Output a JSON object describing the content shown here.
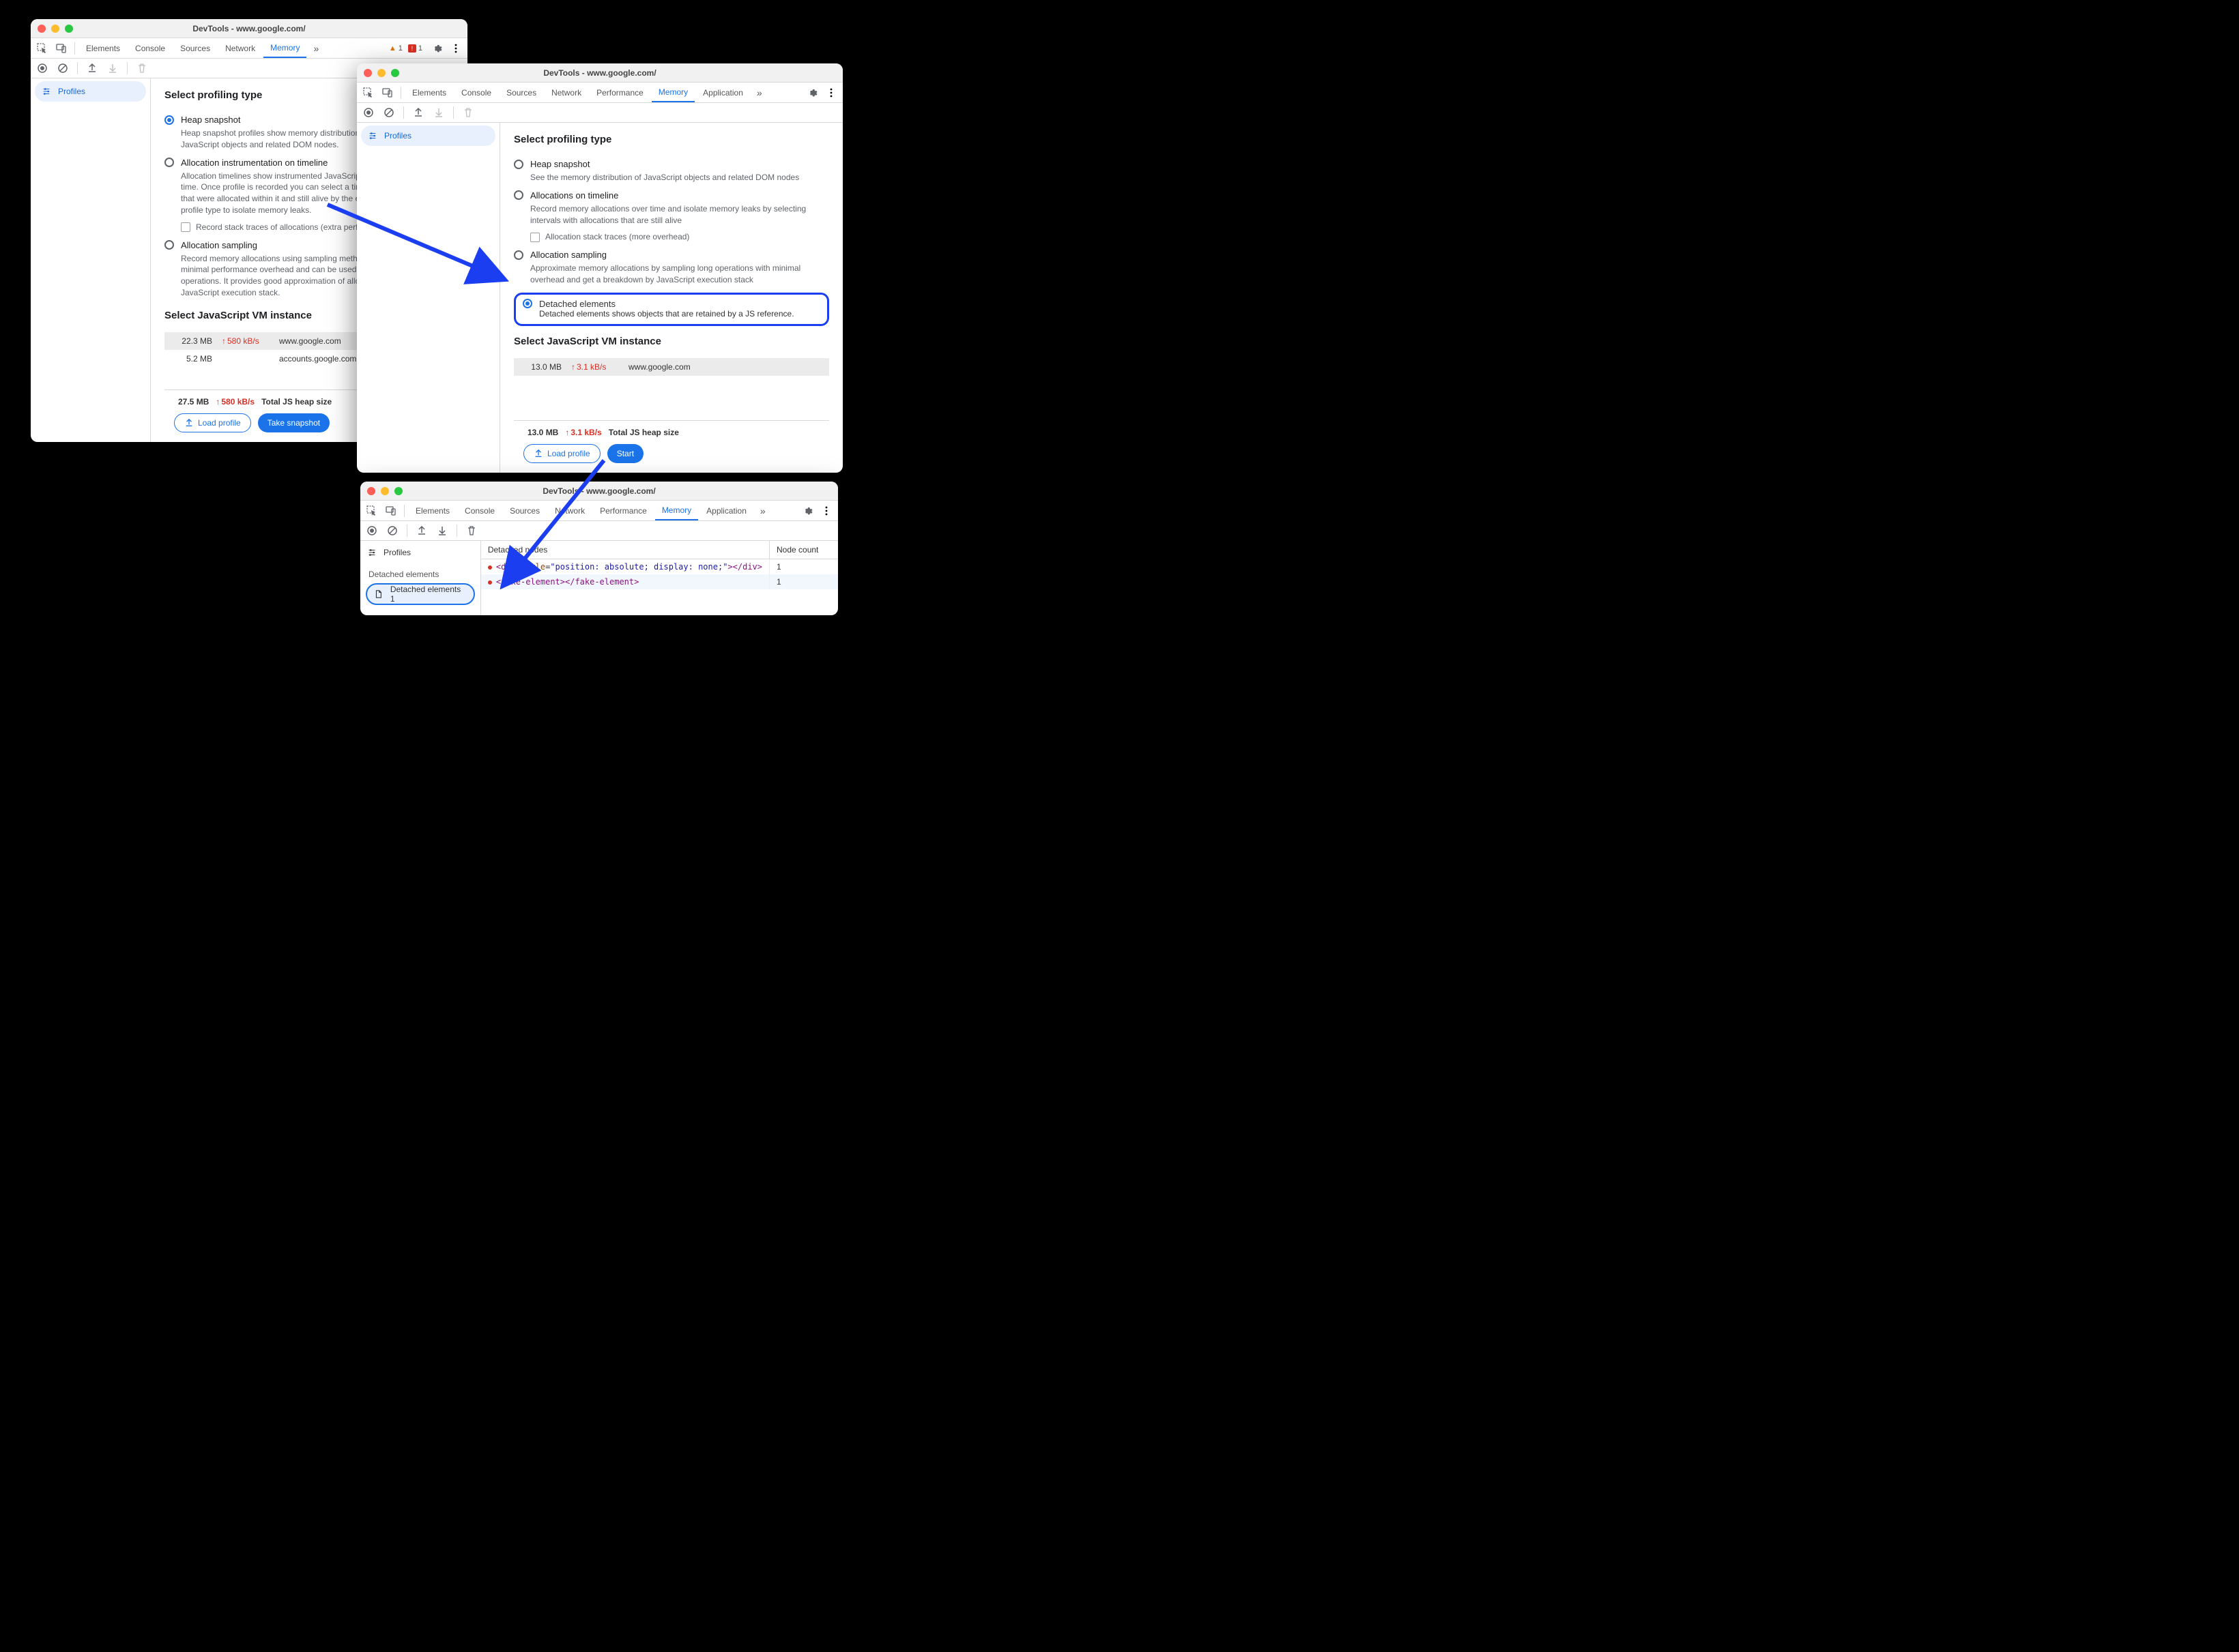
{
  "win1": {
    "title": "DevTools - www.google.com/",
    "tabs": [
      "Elements",
      "Console",
      "Sources",
      "Network",
      "Memory"
    ],
    "activeTab": "Memory",
    "warnCount": "1",
    "errCount": "1",
    "sidebar": {
      "profiles": "Profiles"
    },
    "heading": "Select profiling type",
    "opts": {
      "heap": {
        "label": "Heap snapshot",
        "desc": "Heap snapshot profiles show memory distribution among your page's JavaScript objects and related DOM nodes."
      },
      "timeline": {
        "label": "Allocation instrumentation on timeline",
        "desc": "Allocation timelines show instrumented JavaScript memory allocations over time. Once profile is recorded you can select a time interval to see objects that were allocated within it and still alive by the end of recording. Use this profile type to isolate memory leaks.",
        "check": "Record stack traces of allocations (extra performance overhead)"
      },
      "sampling": {
        "label": "Allocation sampling",
        "desc": "Record memory allocations using sampling method. This profile type has minimal performance overhead and can be used for long running operations. It provides good approximation of allocations broken down by JavaScript execution stack."
      }
    },
    "vmHeading": "Select JavaScript VM instance",
    "vm": [
      {
        "size": "22.3 MB",
        "rate": "580 kB/s",
        "host": "www.google.com"
      },
      {
        "size": "5.2 MB",
        "rate": "",
        "host": "accounts.google.com: Root domain"
      }
    ],
    "total": {
      "size": "27.5 MB",
      "rate": "580 kB/s",
      "label": "Total JS heap size"
    },
    "buttons": {
      "load": "Load profile",
      "snap": "Take snapshot"
    }
  },
  "win2": {
    "title": "DevTools - www.google.com/",
    "tabs": [
      "Elements",
      "Console",
      "Sources",
      "Network",
      "Performance",
      "Memory",
      "Application"
    ],
    "activeTab": "Memory",
    "sidebar": {
      "profiles": "Profiles"
    },
    "heading": "Select profiling type",
    "opts": {
      "heap": {
        "label": "Heap snapshot",
        "desc": "See the memory distribution of JavaScript objects and related DOM nodes"
      },
      "timeline": {
        "label": "Allocations on timeline",
        "desc": "Record memory allocations over time and isolate memory leaks by selecting intervals with allocations that are still alive",
        "check": "Allocation stack traces (more overhead)"
      },
      "sampling": {
        "label": "Allocation sampling",
        "desc": "Approximate memory allocations by sampling long operations with minimal overhead and get a breakdown by JavaScript execution stack"
      },
      "detached": {
        "label": "Detached elements",
        "desc": "Detached elements shows objects that are retained by a JS reference."
      }
    },
    "vmHeading": "Select JavaScript VM instance",
    "vm": [
      {
        "size": "13.0 MB",
        "rate": "3.1 kB/s",
        "host": "www.google.com"
      }
    ],
    "total": {
      "size": "13.0 MB",
      "rate": "3.1 kB/s",
      "label": "Total JS heap size"
    },
    "buttons": {
      "load": "Load profile",
      "start": "Start"
    }
  },
  "win3": {
    "title": "DevTools - www.google.com/",
    "tabs": [
      "Elements",
      "Console",
      "Sources",
      "Network",
      "Performance",
      "Memory",
      "Application"
    ],
    "activeTab": "Memory",
    "sidebar": {
      "profiles": "Profiles",
      "section": "Detached elements",
      "item": "Detached elements 1"
    },
    "grid": {
      "h1": "Detached nodes",
      "h2": "Node count",
      "rows": [
        {
          "html": "<div style=\"position: absolute; display: none;\"></div>",
          "count": "1"
        },
        {
          "html": "<fake-element></fake-element>",
          "count": "1"
        }
      ]
    }
  }
}
